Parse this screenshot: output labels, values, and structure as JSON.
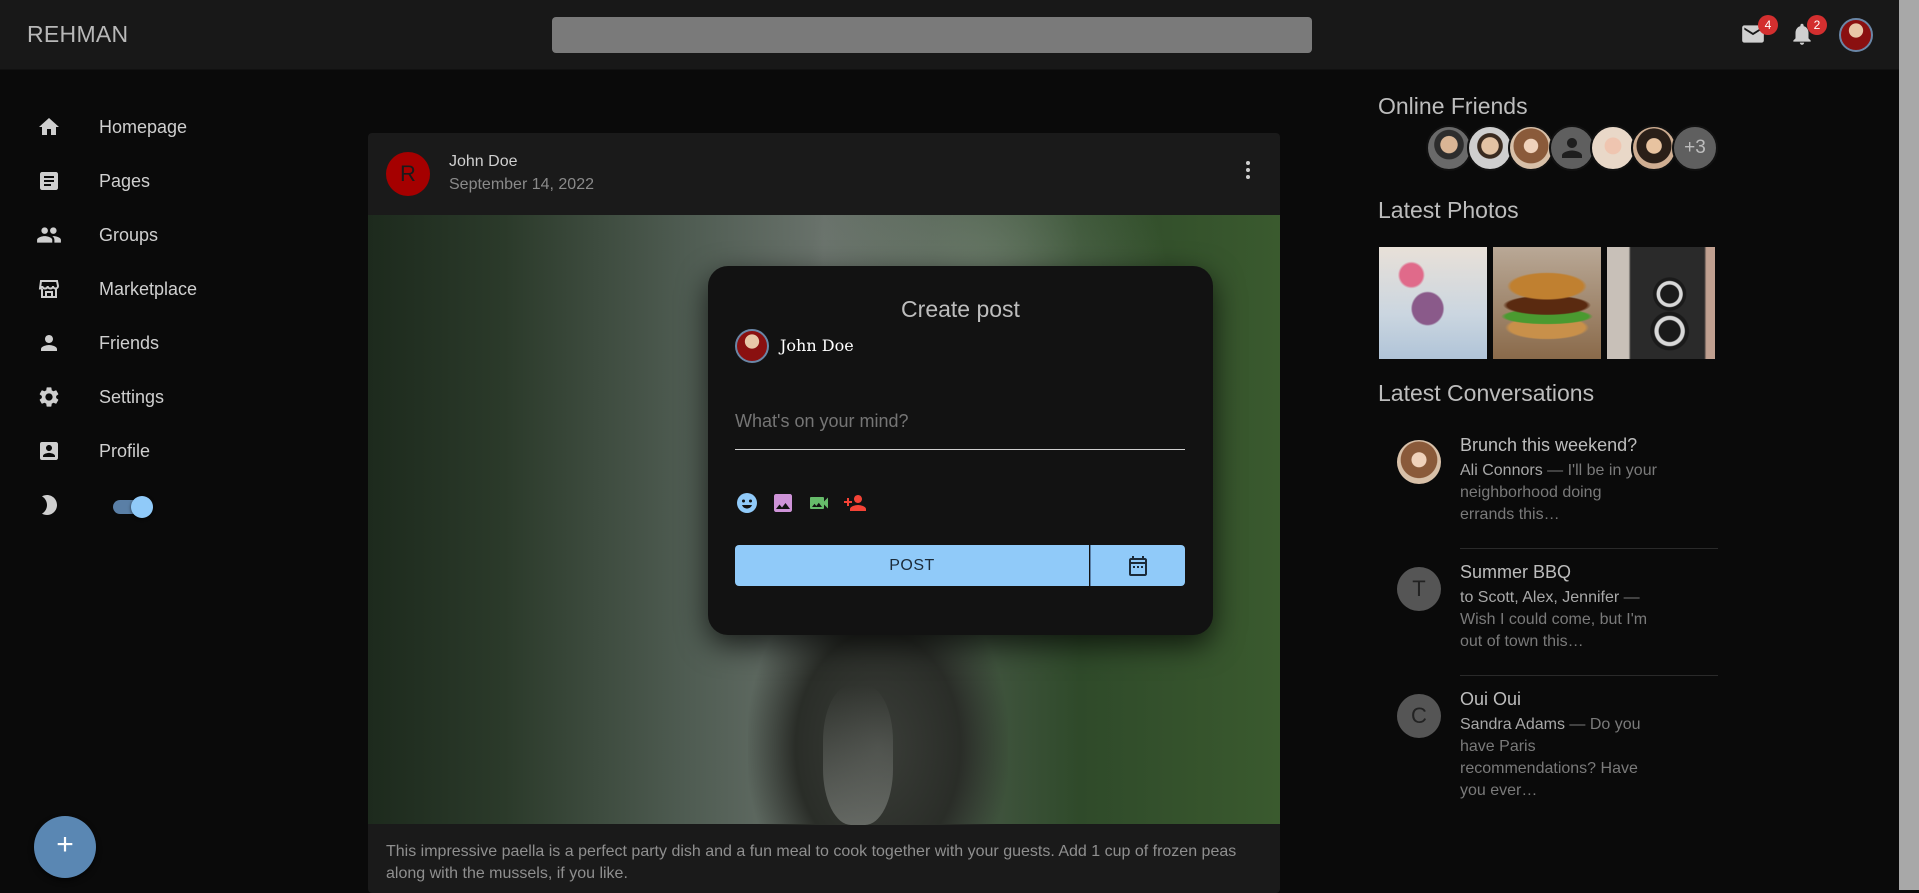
{
  "app": {
    "brand": "REHMAN"
  },
  "header": {
    "search_placeholder": "",
    "mail_badge": "4",
    "notif_badge": "2"
  },
  "sidebar": {
    "items": [
      {
        "label": "Homepage",
        "icon": "home-icon"
      },
      {
        "label": "Pages",
        "icon": "article-icon"
      },
      {
        "label": "Groups",
        "icon": "group-icon"
      },
      {
        "label": "Marketplace",
        "icon": "storefront-icon"
      },
      {
        "label": "Friends",
        "icon": "person-icon"
      },
      {
        "label": "Settings",
        "icon": "gear-icon"
      },
      {
        "label": "Profile",
        "icon": "account-box-icon"
      }
    ],
    "dark_mode": true
  },
  "fab": {
    "label": "+"
  },
  "post": {
    "avatar_letter": "R",
    "author": "John Doe",
    "date": "September 14, 2022",
    "text": "This impressive paella is a perfect party dish and a fun meal to cook together with your guests. Add 1 cup of frozen peas along with the mussels, if you like."
  },
  "modal": {
    "title": "Create post",
    "user": "John Doe",
    "placeholder": "What's on your mind?",
    "post_label": "POST",
    "icon_colors": {
      "emoji": "#90caf9",
      "image": "#ce93d8",
      "video": "#66bb6a",
      "tag": "#f44336"
    }
  },
  "rightbar": {
    "online_title": "Online Friends",
    "online_more": "+3",
    "photos_title": "Latest Photos",
    "conversations_title": "Latest Conversations",
    "conversations": [
      {
        "avatar": "",
        "title": "Brunch this weekend?",
        "who": "Ali Connors",
        "snippet": " — I'll be in your neighborhood doing errands this…"
      },
      {
        "avatar": "T",
        "title": "Summer BBQ",
        "who": "to Scott, Alex, Jennifer",
        "snippet": " — Wish I could come, but I'm out of town this…"
      },
      {
        "avatar": "C",
        "title": "Oui Oui",
        "who": "Sandra Adams",
        "snippet": " — Do you have Paris recommendations? Have you ever…"
      }
    ]
  }
}
